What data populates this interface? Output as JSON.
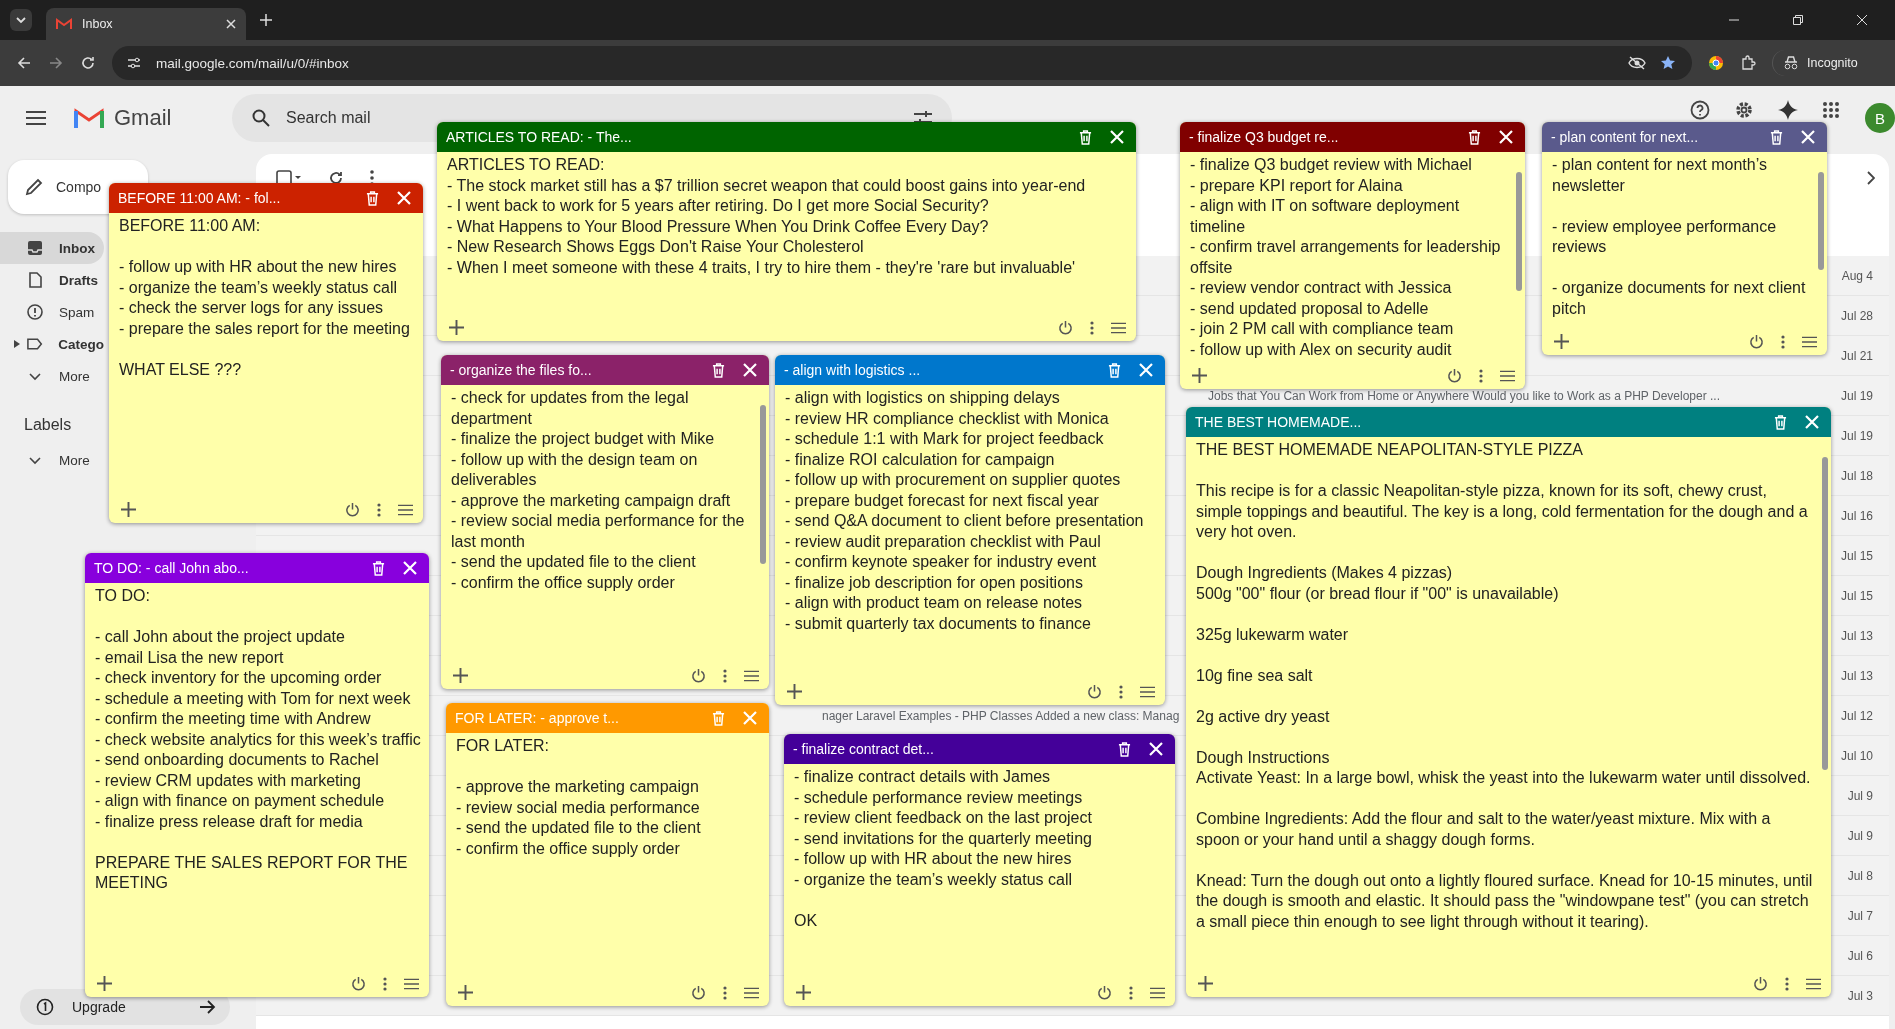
{
  "browser": {
    "tab_title": "Inbox",
    "url": "mail.google.com/mail/u/0/#inbox",
    "mode_label": "Incognito"
  },
  "gmail": {
    "product_name": "Gmail",
    "search": {
      "placeholder": "Search mail"
    },
    "compose_label": "Compo",
    "nav": [
      {
        "label": "Inbox",
        "kind": "inbox",
        "selected": true,
        "unread": true
      },
      {
        "label": "Drafts",
        "kind": "draft",
        "selected": false,
        "unread": true
      },
      {
        "label": "Spam",
        "kind": "spam",
        "selected": false,
        "unread": false
      },
      {
        "label": "Catego",
        "kind": "label",
        "selected": false,
        "unread": true
      },
      {
        "label": "More",
        "kind": "more",
        "selected": false,
        "unread": false
      }
    ],
    "labels_heading": "Labels",
    "labels_more": "More",
    "upgrade": "Upgrade",
    "avatar": "B",
    "rows": [
      {
        "date": "Aug 4"
      },
      {
        "date": "Jul 28"
      },
      {
        "date": "Jul 21"
      },
      {
        "date": "Jul 19",
        "snippet": "Jobs that You Can Work from Home or Anywhere Would you like to Work as a PHP Developer ..."
      },
      {
        "date": "Jul 19"
      },
      {
        "date": "Jul 18"
      },
      {
        "date": "Jul 16"
      },
      {
        "date": "Jul 15"
      },
      {
        "date": "Jul 15"
      },
      {
        "date": "Jul 13"
      },
      {
        "date": "Jul 13"
      },
      {
        "date": "Jul 12",
        "snippet": "nager Laravel Examples - PHP Classes Added a new class: Manag"
      },
      {
        "date": "Jul 10"
      },
      {
        "date": "Jul 9"
      },
      {
        "date": "Jul 9"
      },
      {
        "date": "Jul 8"
      },
      {
        "date": "Jul 7"
      },
      {
        "date": "Jul 6"
      },
      {
        "date": "Jul 3"
      }
    ]
  },
  "notes": [
    {
      "title": "BEFORE 11:00 AM: - fol...",
      "color": "#cc2200",
      "scrollbar": false,
      "paragraphs": [
        [
          "BEFORE 11:00 AM:"
        ],
        [
          "- follow up with HR about the new hires",
          "- organize the team’s weekly status call",
          "- check the server logs for any issues",
          "- prepare the sales report for the meeting"
        ],
        [
          "WHAT ELSE ???"
        ]
      ]
    },
    {
      "title": "ARTICLES TO READ: - The...",
      "color": "#006400",
      "scrollbar": false,
      "paragraphs": [
        [
          "ARTICLES TO READ:",
          "- The stock market still has a $7 trillion secret weapon that could boost gains into year-end",
          "- I went back to work for 5 years after retiring. Do I get more Social Security?",
          "- What Happens to Your Blood Pressure When You Drink Coffee Every Day?",
          "- New Research Shows Eggs Don't Raise Your Cholesterol",
          "- When I meet someone with these 4 traits, I try to hire them - they're 'rare but invaluable'"
        ]
      ]
    },
    {
      "title": "- organize the files fo...",
      "color": "#8b2269",
      "scrollbar": true,
      "paragraphs": [
        [
          "- check for updates from the legal department",
          "- finalize the project budget with Mike",
          "- follow up with the design team on deliverables",
          "- approve the marketing campaign draft",
          "- review social media performance for the last month",
          "- send the updated file to the client",
          "- confirm the office supply order"
        ]
      ]
    },
    {
      "title": "- align with logistics ...",
      "color": "#0077cc",
      "scrollbar": false,
      "paragraphs": [
        [
          "- align with logistics on shipping delays",
          "- review HR compliance checklist with Monica",
          "- schedule 1:1 with Mark for project feedback",
          "- finalize ROI calculation for campaign",
          "- follow up with procurement on supplier quotes",
          "- prepare budget forecast for next fiscal year",
          "- send Q&A document to client before presentation",
          "- review audit preparation checklist with Paul",
          "- confirm keynote speaker for industry event",
          "- finalize job description for open positions",
          "- align with product team on release notes",
          "- submit quarterly tax documents to finance"
        ]
      ]
    },
    {
      "title": "- finalize Q3 budget re...",
      "color": "#800000",
      "scrollbar": true,
      "paragraphs": [
        [
          "- finalize Q3 budget review with Michael",
          "- prepare KPI report for Alaina",
          "- align with IT on software deployment timeline",
          "- confirm travel arrangements for leadership offsite",
          "- review vendor contract with Jessica",
          "- send updated proposal to Adelle",
          "- join 2 PM call with compliance team",
          "- follow up with Alex on security audit"
        ]
      ]
    },
    {
      "title": "- plan content for next...",
      "color": "#5a5a8c",
      "scrollbar": true,
      "paragraphs": [
        [
          "- plan content for next month’s newsletter"
        ],
        [
          "- review employee performance reviews"
        ],
        [
          "- organize documents for next client pitch"
        ]
      ]
    },
    {
      "title": "THE BEST HOMEMADE...",
      "color": "#008080",
      "scrollbar": true,
      "paragraphs": [
        [
          "THE BEST HOMEMADE NEAPOLITAN-STYLE PIZZA"
        ],
        [
          "This recipe is for a classic Neapolitan-style pizza, known for its soft, chewy crust, simple toppings and beautiful. The key is a long, cold fermentation for the dough and a very hot oven."
        ],
        [
          "Dough Ingredients (Makes 4 pizzas)",
          "500g \"00\" flour (or bread flour if \"00\" is unavailable)"
        ],
        [
          "325g lukewarm water"
        ],
        [
          "10g fine sea salt"
        ],
        [
          "2g active dry yeast"
        ],
        [
          "Dough Instructions",
          "Activate Yeast: In a large bowl, whisk the yeast into the lukewarm water until dissolved."
        ],
        [
          "Combine Ingredients: Add the flour and salt to the water/yeast mixture. Mix with a spoon or your hand until a shaggy dough forms."
        ],
        [
          "Knead: Turn the dough out onto a lightly floured surface. Knead for 10-15 minutes, until the dough is smooth and elastic. It should pass the \"windowpane test\" (you can stretch a small piece thin enough to see light through without it tearing)."
        ]
      ]
    },
    {
      "title": "TO DO: - call John abo...",
      "color": "#8800dd",
      "scrollbar": false,
      "paragraphs": [
        [
          "TO DO:"
        ],
        [
          "- call John about the project update",
          "- email Lisa the new report",
          "- check inventory for the upcoming order",
          "- schedule a meeting with Tom for next week",
          "- confirm the meeting time with Andrew",
          "- check website analytics for this week’s traffic",
          "- send onboarding documents to Rachel",
          "- review CRM updates with marketing",
          "- align with finance on payment schedule",
          "- finalize press release draft for media"
        ],
        [
          "PREPARE THE SALES REPORT FOR THE MEETING"
        ]
      ]
    },
    {
      "title": "FOR LATER: - approve t...",
      "color": "#ff9900",
      "scrollbar": false,
      "paragraphs": [
        [
          "FOR LATER:"
        ],
        [
          "- approve the marketing campaign",
          "- review social media performance",
          "- send the updated file to the client",
          "- confirm the office supply order"
        ]
      ]
    },
    {
      "title": "- finalize contract det...",
      "color": "#440099",
      "scrollbar": false,
      "paragraphs": [
        [
          "- finalize contract details with James",
          "- schedule performance review meetings",
          "- review client feedback on the last project",
          "- send invitations for the quarterly meeting",
          "- follow up with HR about the new hires",
          "- organize the team’s weekly status call"
        ],
        [
          "OK"
        ]
      ]
    }
  ]
}
